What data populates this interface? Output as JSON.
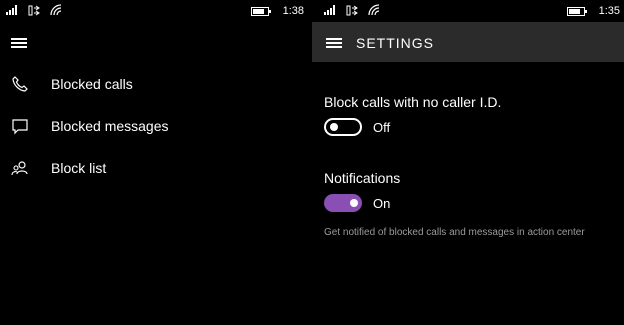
{
  "left_screen": {
    "status": {
      "time": "1:38",
      "battery_level": 0.7
    },
    "menu_icon": "hamburger-icon",
    "nav": [
      {
        "label": "Blocked calls",
        "icon": "phone-icon"
      },
      {
        "label": "Blocked messages",
        "icon": "message-icon"
      },
      {
        "label": "Block list",
        "icon": "people-icon"
      }
    ]
  },
  "right_screen": {
    "status": {
      "time": "1:35",
      "battery_level": 0.7
    },
    "header": {
      "title": "SETTINGS"
    },
    "settings": [
      {
        "label": "Block calls with no caller I.D.",
        "state": "Off",
        "enabled": false
      },
      {
        "label": "Notifications",
        "state": "On",
        "enabled": true,
        "hint": "Get notified of blocked calls and messages in action center"
      }
    ]
  },
  "colors": {
    "accent": "#8a4fb4",
    "header_bg": "#2b2b2b",
    "background": "#000000",
    "hint_text": "#9a9a9a"
  }
}
